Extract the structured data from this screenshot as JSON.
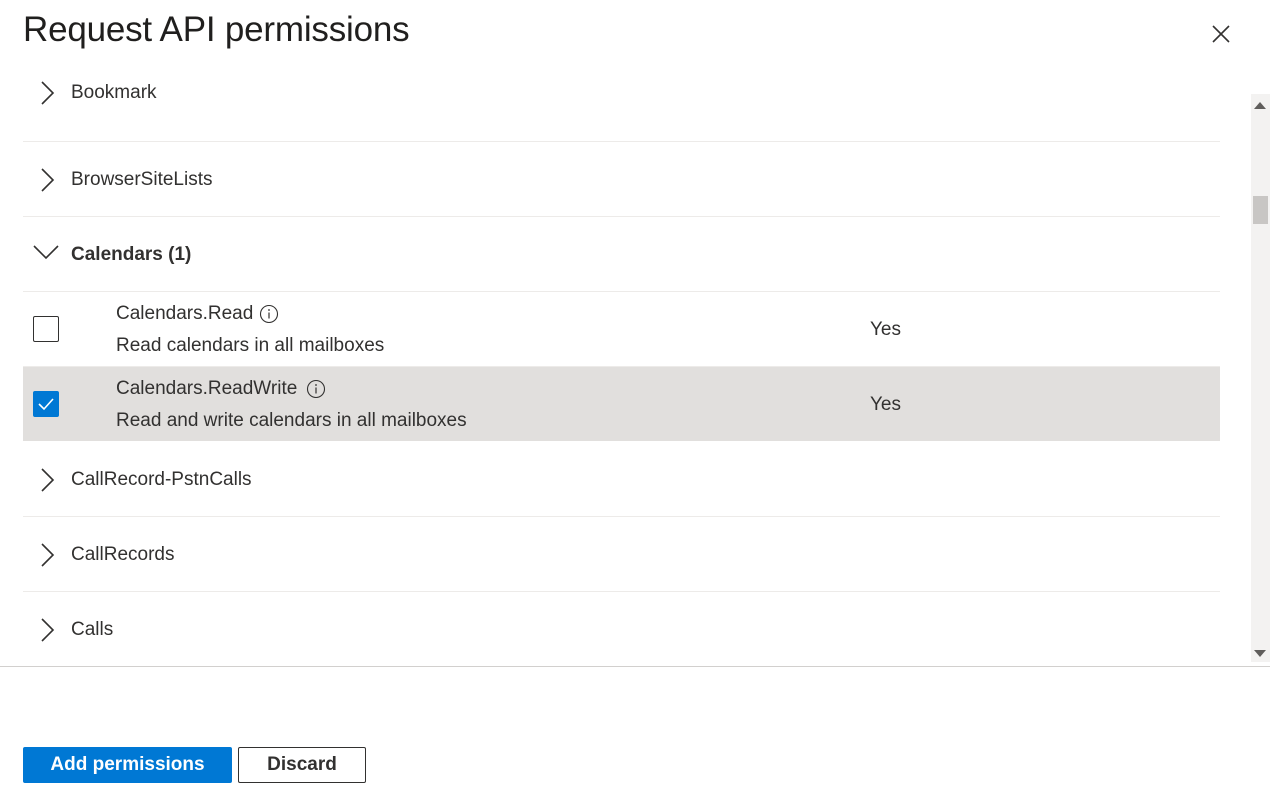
{
  "panel": {
    "title": "Request API permissions",
    "close_icon": "close-icon"
  },
  "groups": [
    {
      "label": "Bookmark",
      "expanded": false,
      "icon": "chevron-right-icon"
    },
    {
      "label": "BrowserSiteLists",
      "expanded": false,
      "icon": "chevron-right-icon"
    },
    {
      "label": "Calendars (1)",
      "expanded": true,
      "icon": "chevron-down-icon"
    },
    {
      "label": "CallRecord-PstnCalls",
      "expanded": false,
      "icon": "chevron-right-icon"
    },
    {
      "label": "CallRecords",
      "expanded": false,
      "icon": "chevron-right-icon"
    },
    {
      "label": "Calls",
      "expanded": false,
      "icon": "chevron-right-icon"
    }
  ],
  "permissions": [
    {
      "name": "Calendars.Read",
      "description": "Read calendars in all mailboxes",
      "admin_consent": "Yes",
      "checked": false
    },
    {
      "name": "Calendars.ReadWrite",
      "description": "Read and write calendars in all mailboxes",
      "admin_consent": "Yes",
      "checked": true
    }
  ],
  "footer": {
    "add_label": "Add permissions",
    "discard_label": "Discard"
  },
  "colors": {
    "accent": "#0078d4",
    "selected_row": "#e1dfdd"
  }
}
